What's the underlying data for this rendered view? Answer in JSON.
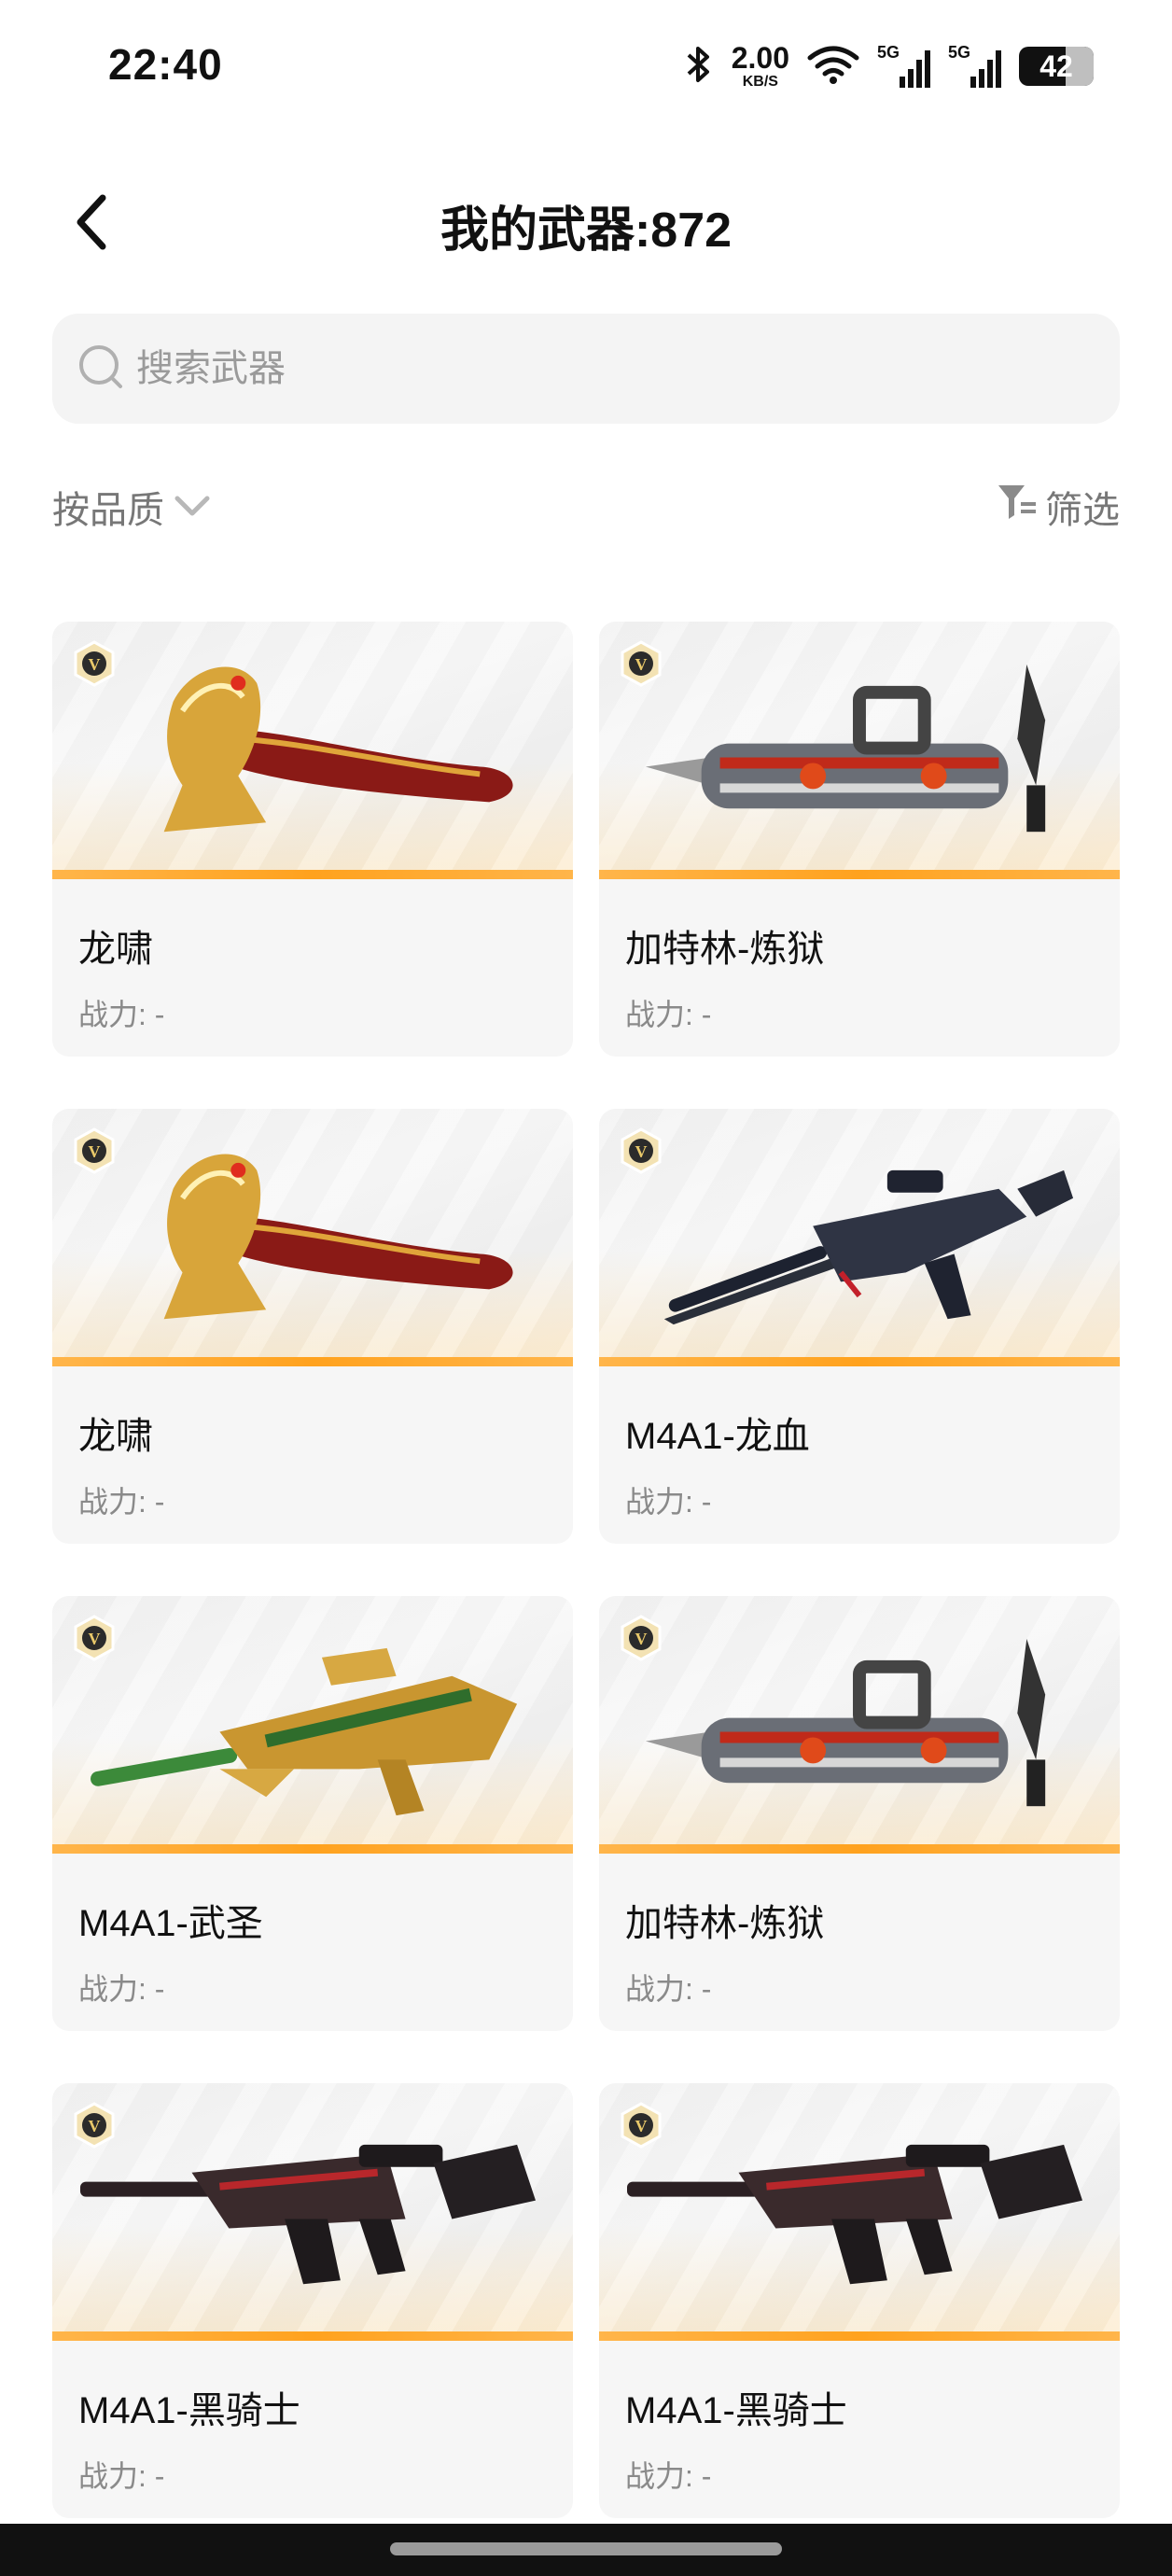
{
  "status_bar": {
    "time": "22:40",
    "net_speed_value": "2.00",
    "net_speed_unit": "KB/S",
    "sim1_label": "5G",
    "sim2_label": "5G",
    "battery_level": "42",
    "icons": [
      "bluetooth-icon",
      "wifi-icon",
      "signal-icon",
      "signal-icon",
      "battery-icon"
    ]
  },
  "header": {
    "title": "我的武器:872",
    "back_icon": "back-arrow-icon"
  },
  "search": {
    "placeholder": "搜索武器",
    "value": ""
  },
  "toolbar": {
    "sort_label": "按品质",
    "filter_label": "筛选"
  },
  "colors": {
    "accent_bar": "#ffa21e",
    "text_primary": "#111111",
    "text_secondary": "#8a8a8a",
    "card_bg": "#f6f6f6"
  },
  "weapons": [
    {
      "name": "龙啸",
      "power": "战力: -",
      "badge": "V",
      "image": "axe-weapon-icon"
    },
    {
      "name": "加特林-炼狱",
      "power": "战力: -",
      "badge": "V",
      "image": "gatling-weapon-icon"
    },
    {
      "name": "龙啸",
      "power": "战力: -",
      "badge": "V",
      "image": "axe-weapon-icon"
    },
    {
      "name": "M4A1-龙血",
      "power": "战力: -",
      "badge": "V",
      "image": "rifle-weapon-icon"
    },
    {
      "name": "M4A1-武圣",
      "power": "战力: -",
      "badge": "V",
      "image": "rifle-weapon-icon"
    },
    {
      "name": "加特林-炼狱",
      "power": "战力: -",
      "badge": "V",
      "image": "gatling-weapon-icon"
    },
    {
      "name": "M4A1-黑骑士",
      "power": "战力: -",
      "badge": "V",
      "image": "rifle-weapon-icon"
    },
    {
      "name": "M4A1-黑骑士",
      "power": "战力: -",
      "badge": "V",
      "image": "rifle-weapon-icon"
    }
  ]
}
